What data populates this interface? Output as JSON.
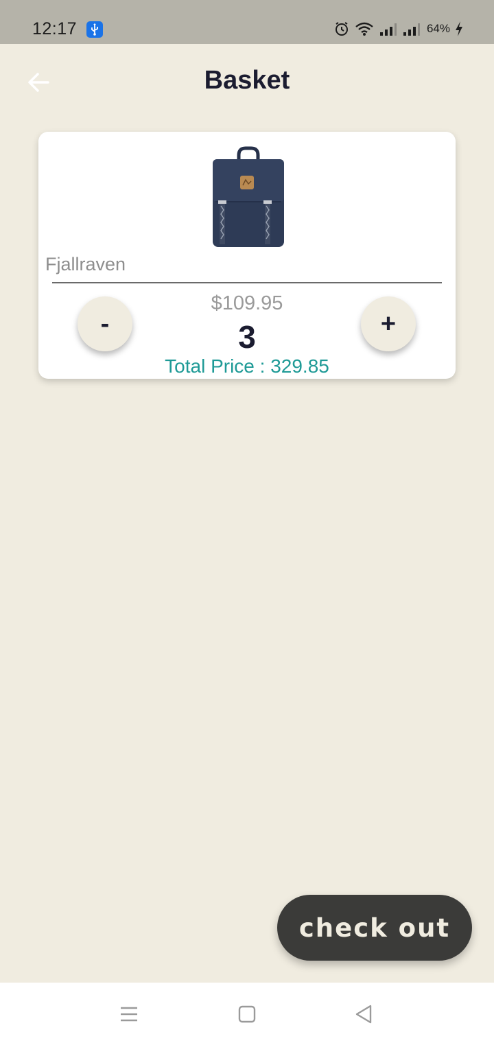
{
  "status_bar": {
    "time": "12:17",
    "battery": "64%",
    "icons": [
      "usb-icon",
      "alarm-icon",
      "wifi-icon",
      "signal-icon",
      "signal-icon",
      "charging-icon"
    ]
  },
  "header": {
    "title": "Basket",
    "back_icon": "arrow-left-icon"
  },
  "basket": {
    "items": [
      {
        "name": "Fjallraven",
        "unit_price": "$109.95",
        "quantity": "3",
        "total_price": "Total Price : 329.85",
        "decrement_label": "-",
        "increment_label": "+",
        "image": "backpack-image"
      }
    ]
  },
  "checkout": {
    "label": "check out"
  },
  "nav_bar": {
    "icons": [
      "menu-icon",
      "home-icon",
      "back-icon"
    ]
  },
  "colors": {
    "background": "#f0ece0",
    "title": "#1b1c30",
    "total_price": "#1e9a96",
    "checkout_button": "#3b3b39"
  }
}
